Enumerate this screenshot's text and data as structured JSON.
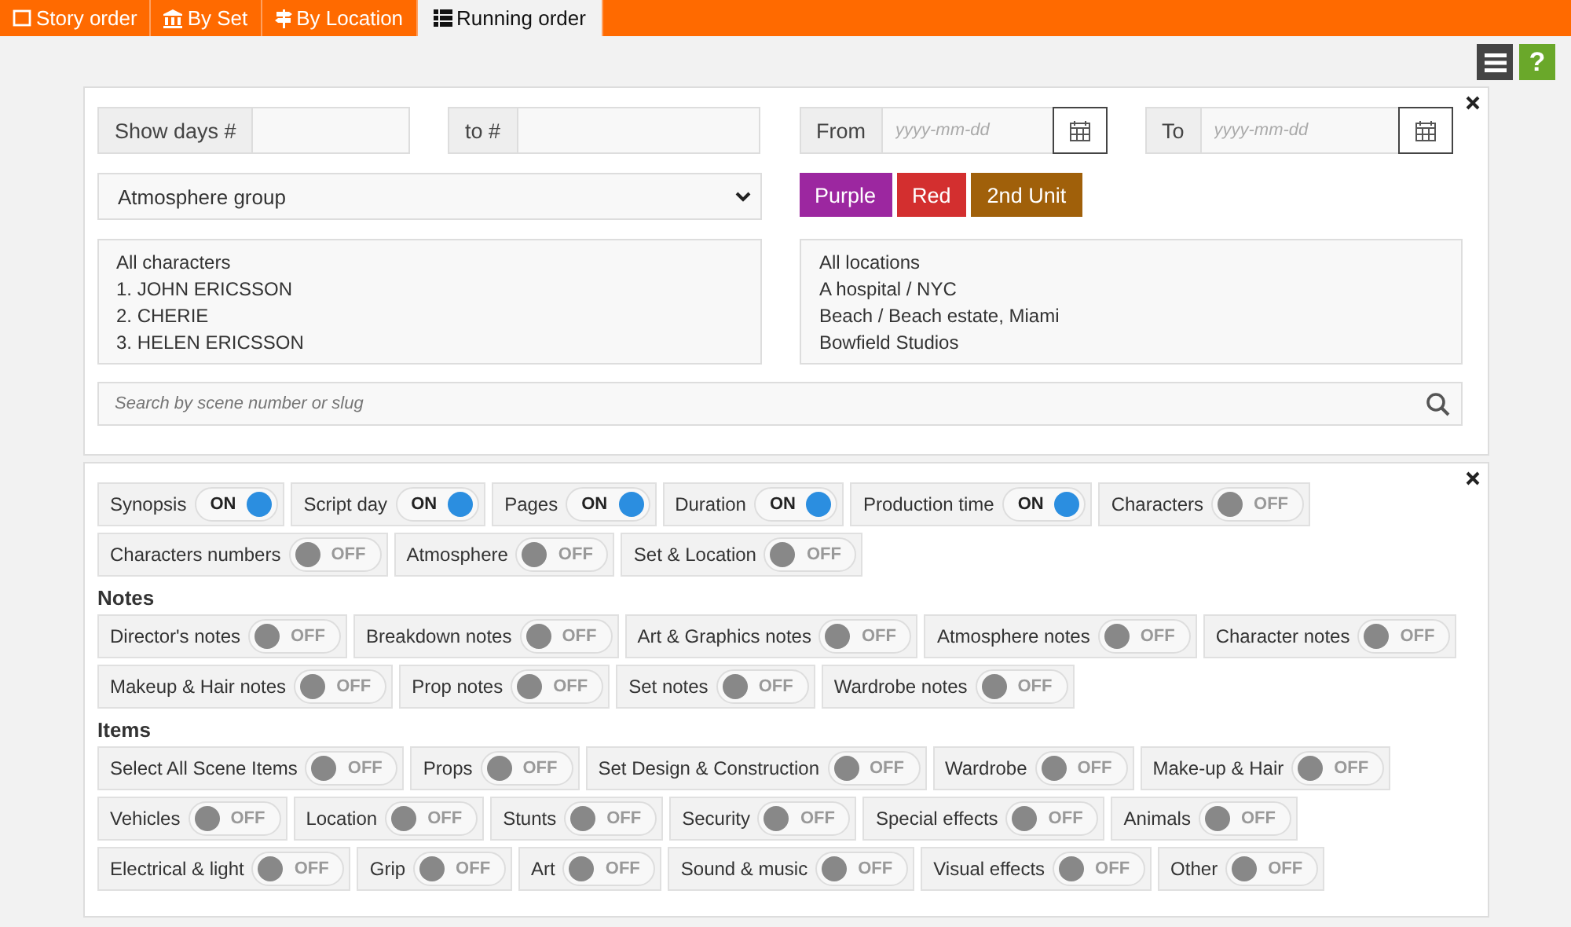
{
  "tabs": [
    {
      "label": "Story order",
      "selected": false
    },
    {
      "label": "By Set",
      "selected": false
    },
    {
      "label": "By Location",
      "selected": false
    },
    {
      "label": "Running order",
      "selected": true
    }
  ],
  "toolbar": {
    "help": "?"
  },
  "filters": {
    "show_days": {
      "label": "Show days #"
    },
    "to_day": {
      "label": "to #"
    },
    "from_date": {
      "label": "From",
      "placeholder": "yyyy-mm-dd"
    },
    "to_date": {
      "label": "To",
      "placeholder": "yyyy-mm-dd"
    },
    "group_select": {
      "value": "Atmosphere group"
    },
    "color_buttons": [
      {
        "label": "Purple",
        "color": "#9c27a0"
      },
      {
        "label": "Red",
        "color": "#d32f2f"
      },
      {
        "label": "2nd Unit",
        "color": "#a0600a"
      }
    ],
    "characters": [
      "All characters",
      "1. JOHN ERICSSON",
      "2. CHERIE",
      "3. HELEN ERICSSON"
    ],
    "locations": [
      "All locations",
      "A hospital / NYC",
      "Beach / Beach estate, Miami",
      "Bowfield Studios"
    ],
    "search": {
      "placeholder": "Search by scene number or slug"
    }
  },
  "sections": [
    {
      "toggles": [
        {
          "label": "Synopsis",
          "on": true,
          "state": "ON"
        },
        {
          "label": "Script day",
          "on": true,
          "state": "ON"
        },
        {
          "label": "Pages",
          "on": true,
          "state": "ON"
        },
        {
          "label": "Duration",
          "on": true,
          "state": "ON"
        },
        {
          "label": "Production time",
          "on": true,
          "state": "ON"
        },
        {
          "label": "Characters",
          "on": false,
          "state": "OFF"
        },
        {
          "label": "Characters numbers",
          "on": false,
          "state": "OFF"
        },
        {
          "label": "Atmosphere",
          "on": false,
          "state": "OFF"
        },
        {
          "label": "Set & Location",
          "on": false,
          "state": "OFF"
        }
      ]
    },
    {
      "heading": "Notes",
      "toggles": [
        {
          "label": "Director's notes",
          "on": false,
          "state": "OFF"
        },
        {
          "label": "Breakdown notes",
          "on": false,
          "state": "OFF"
        },
        {
          "label": "Art & Graphics notes",
          "on": false,
          "state": "OFF"
        },
        {
          "label": "Atmosphere notes",
          "on": false,
          "state": "OFF"
        },
        {
          "label": "Character notes",
          "on": false,
          "state": "OFF"
        },
        {
          "label": "Makeup & Hair notes",
          "on": false,
          "state": "OFF"
        },
        {
          "label": "Prop notes",
          "on": false,
          "state": "OFF"
        },
        {
          "label": "Set notes",
          "on": false,
          "state": "OFF"
        },
        {
          "label": "Wardrobe notes",
          "on": false,
          "state": "OFF"
        }
      ]
    },
    {
      "heading": "Items",
      "toggles": [
        {
          "label": "Select All Scene Items",
          "on": false,
          "state": "OFF"
        },
        {
          "label": "Props",
          "on": false,
          "state": "OFF"
        },
        {
          "label": "Set Design & Construction",
          "on": false,
          "state": "OFF"
        },
        {
          "label": "Wardrobe",
          "on": false,
          "state": "OFF"
        },
        {
          "label": "Make-up & Hair",
          "on": false,
          "state": "OFF"
        },
        {
          "label": "Vehicles",
          "on": false,
          "state": "OFF"
        },
        {
          "label": "Location",
          "on": false,
          "state": "OFF"
        },
        {
          "label": "Stunts",
          "on": false,
          "state": "OFF"
        },
        {
          "label": "Security",
          "on": false,
          "state": "OFF"
        },
        {
          "label": "Special effects",
          "on": false,
          "state": "OFF"
        },
        {
          "label": "Animals",
          "on": false,
          "state": "OFF"
        },
        {
          "label": "Electrical & light",
          "on": false,
          "state": "OFF"
        },
        {
          "label": "Grip",
          "on": false,
          "state": "OFF"
        },
        {
          "label": "Art",
          "on": false,
          "state": "OFF"
        },
        {
          "label": "Sound & music",
          "on": false,
          "state": "OFF"
        },
        {
          "label": "Visual effects",
          "on": false,
          "state": "OFF"
        },
        {
          "label": "Other",
          "on": false,
          "state": "OFF"
        }
      ]
    }
  ]
}
